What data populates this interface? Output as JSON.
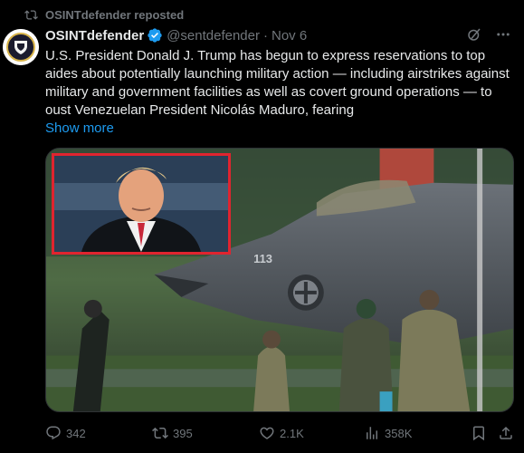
{
  "repost": {
    "label": "OSINTdefender reposted"
  },
  "author": {
    "display_name": "OSINTdefender",
    "handle": "@sentdefender",
    "separator": "·",
    "date": "Nov 6"
  },
  "tweet": {
    "text": "U.S. President Donald J. Trump has begun to express reservations to top aides about potentially launching military action — including airstrikes against military and government facilities as well as covert ground operations — to oust Venezuelan President Nicolás Maduro, fearing",
    "show_more": "Show more"
  },
  "media": {
    "jet_number": "113"
  },
  "actions": {
    "replies": "342",
    "reposts": "395",
    "likes": "2.1K",
    "views": "358K"
  },
  "colors": {
    "accent": "#1d9bf0",
    "muted": "#71767b",
    "text": "#e7e9ea",
    "inset_border": "#e0242f"
  },
  "icons": [
    "repost-icon",
    "verified-badge-icon",
    "grok-icon",
    "more-icon",
    "reply-icon",
    "repost-icon",
    "like-icon",
    "views-icon",
    "bookmark-icon",
    "share-icon"
  ]
}
